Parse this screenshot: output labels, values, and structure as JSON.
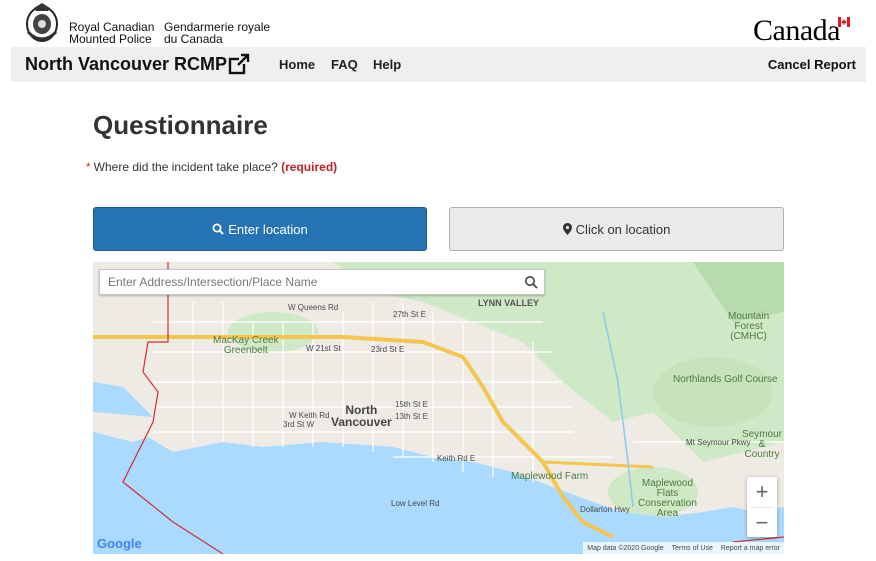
{
  "header": {
    "org_en_line1": "Royal Canadian",
    "org_en_line2": "Mounted Police",
    "org_fr_line1": "Gendarmerie royale",
    "org_fr_line2": "du Canada",
    "wordmark": "Canada"
  },
  "nav": {
    "site_title": "North Vancouver RCMP",
    "home": "Home",
    "faq": "FAQ",
    "help": "Help",
    "cancel": "Cancel Report"
  },
  "main": {
    "title": "Questionnaire",
    "question_marker": "*",
    "question": "Where did the incident take place?",
    "required": "(required)",
    "enter_location_label": "Enter location",
    "click_location_label": "Click on location"
  },
  "map": {
    "search_placeholder": "Enter Address/Intersection/Place Name",
    "zoom_in": "+",
    "zoom_out": "−",
    "labels": {
      "lynn_valley": "LYNN VALLEY",
      "mackay_line1": "MacKay Creek",
      "mackay_line2": "Greenbelt",
      "nv_line1": "North",
      "nv_line2": "Vancouver",
      "forest_line1": "Mountain",
      "forest_line2": "Forest",
      "forest_line3": "(CMHC)",
      "golf": "Northlands Golf Course",
      "maplewood_farm": "Maplewood Farm",
      "flats_line1": "Maplewood",
      "flats_line2": "Flats",
      "flats_line3": "Conservation",
      "flats_line4": "Area",
      "seymour_line1": "Seymour",
      "seymour_line2": "& Country",
      "w_queens": "W Queens Rd",
      "st27": "27th St E",
      "st23": "23rd St E",
      "st21": "W 21st St",
      "st13": "13th St E",
      "st15": "15th St E",
      "keith": "Keith Rd E",
      "lowlevel": "Low Level Rd",
      "dollarton": "Dollarton Hwy",
      "mtseymour": "Mt Seymour Pkwy",
      "keith_w": "W Keith Rd",
      "st3": "3rd St W"
    },
    "attribution": {
      "data": "Map data ©2020 Google",
      "terms": "Terms of Use",
      "report": "Report a map error"
    },
    "google_logo": "Google",
    "colors": {
      "water": "#aadaff",
      "park": "#c8e6c9",
      "highway": "#f9d66c",
      "boundary": "#d32f2f"
    }
  }
}
